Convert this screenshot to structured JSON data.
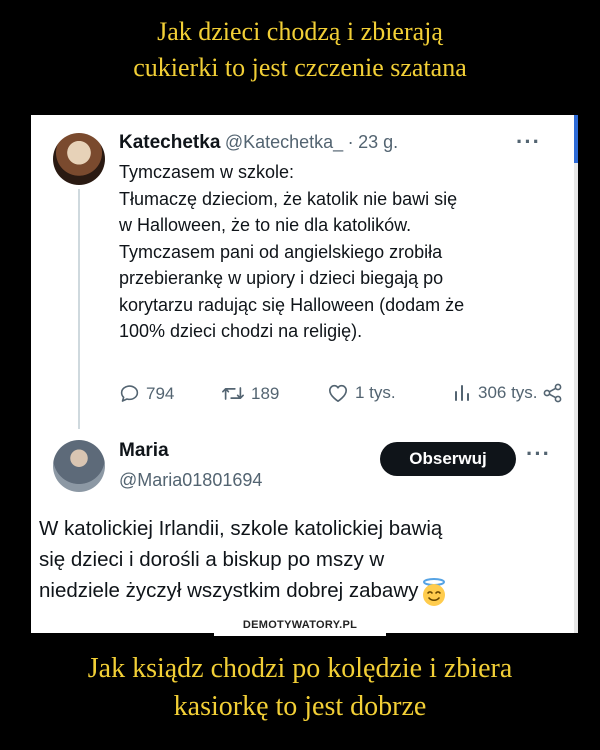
{
  "captions": {
    "top_line1": "Jak dzieci chodzą i zbierają",
    "top_line2": "cukierki to jest czczenie szatana",
    "bottom_line1": "Jak ksiądz chodzi po kolędzie i zbiera",
    "bottom_line2": "kasiorkę to jest dobrze"
  },
  "tweet": {
    "author_name": "Katechetka",
    "handle": "@Katechetka_",
    "separator": "·",
    "time": "23 g.",
    "more": "···",
    "lines": [
      "Tymczasem w szkole:",
      "Tłumaczę dzieciom, że katolik nie bawi się",
      "w Halloween, że to nie dla katolików.",
      "Tymczasem pani od angielskiego zrobiła",
      "przebierankę w upiory i dzieci biegają po",
      "korytarzu radując się Halloween (dodam że",
      "100% dzieci chodzi na religię)."
    ],
    "stats": {
      "replies": "794",
      "retweets": "189",
      "likes": "1 tys.",
      "views": "306 tys."
    }
  },
  "reply": {
    "author_name": "Maria",
    "handle": "@Maria01801694",
    "follow_label": "Obserwuj",
    "more": "···",
    "lines": [
      "W katolickiej Irlandii, szkole katolickiej bawią",
      "się dzieci i dorośli a biskup po mszy w",
      "niedziele życzył wszystkim dobrej zabawy"
    ],
    "emoji": "smiling-face-with-halo"
  },
  "watermark": "DEMOTYWATORY.PL",
  "colors": {
    "caption": "#f2cf36",
    "background": "#000000",
    "text": "#0f1419",
    "muted": "#536471",
    "button_bg": "#0f1419"
  }
}
